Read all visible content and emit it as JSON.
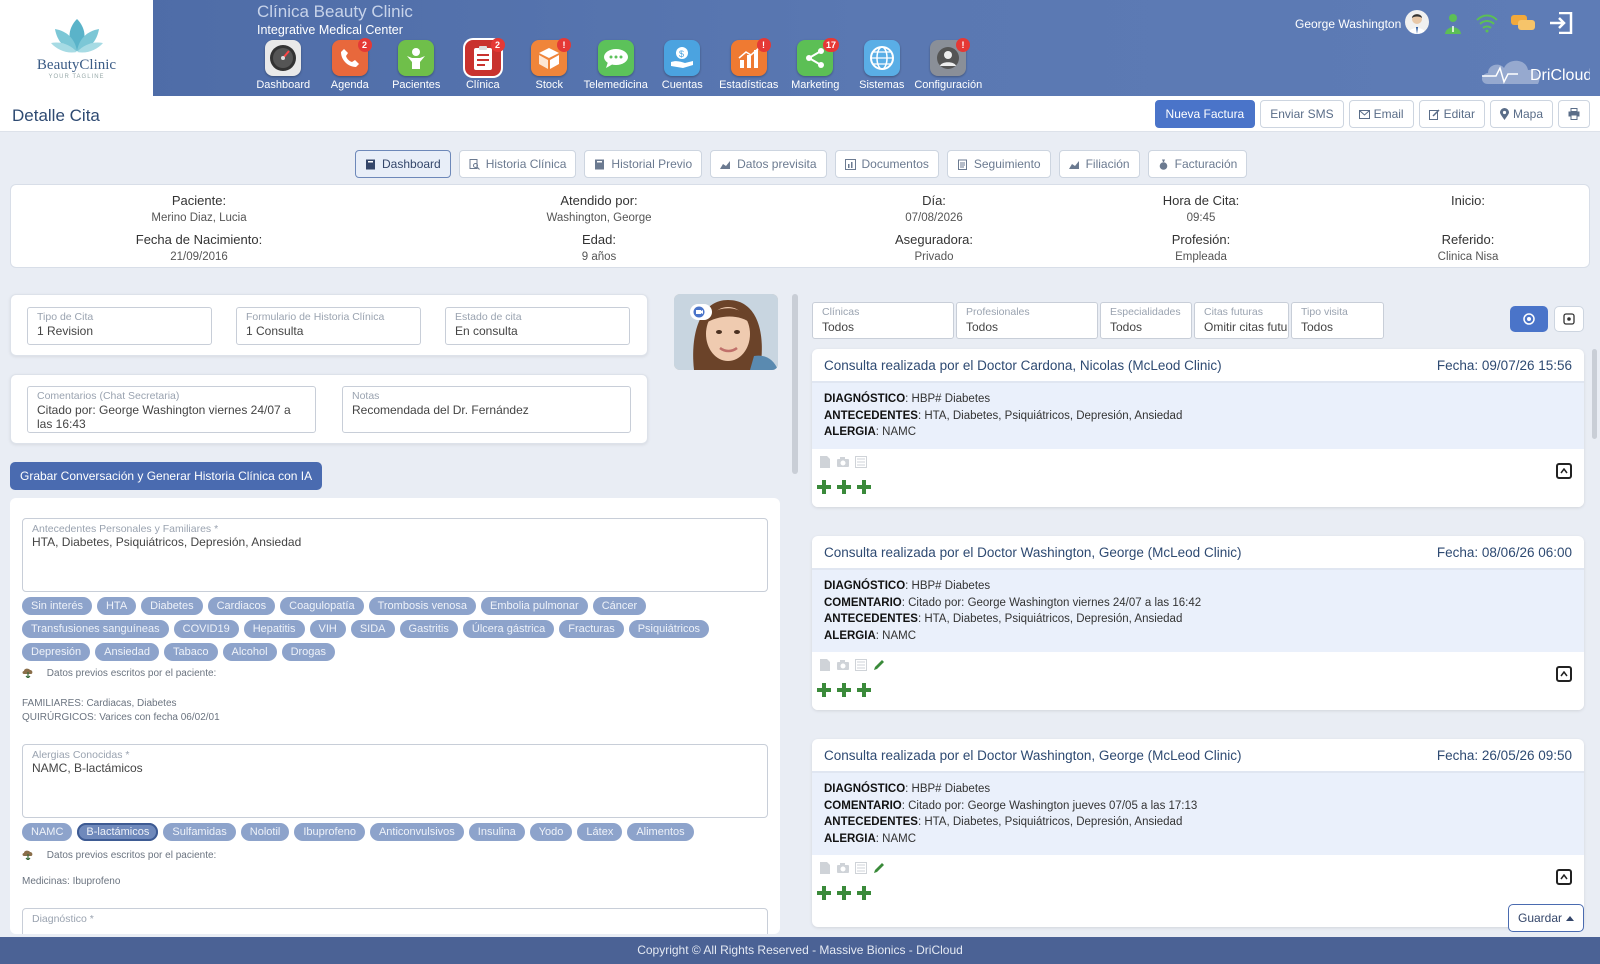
{
  "brand": {
    "name": "BeautyClinic",
    "tagline": "YOUR TAGLINE"
  },
  "header": {
    "clinic_title": "Clínica Beauty Clinic",
    "clinic_subtitle": "Integrative Medical Center",
    "user_name": "George Washington",
    "cloud_brand": "DriCloud"
  },
  "nav": [
    {
      "label": "Dashboard",
      "icon": "speedometer-icon",
      "badge": ""
    },
    {
      "label": "Agenda",
      "icon": "phone-icon",
      "badge": "2"
    },
    {
      "label": "Pacientes",
      "icon": "patient-icon",
      "badge": ""
    },
    {
      "label": "Clínica",
      "icon": "clipboard-icon",
      "badge": "2"
    },
    {
      "label": "Stock",
      "icon": "box-icon",
      "badge": "!"
    },
    {
      "label": "Telemedicina",
      "icon": "chat-icon",
      "badge": ""
    },
    {
      "label": "Cuentas",
      "icon": "money-hand-icon",
      "badge": ""
    },
    {
      "label": "Estadísticas",
      "icon": "bar-chart-icon",
      "badge": "!"
    },
    {
      "label": "Marketing",
      "icon": "share-icon",
      "badge": "17"
    },
    {
      "label": "Sistemas",
      "icon": "globe-icon",
      "badge": ""
    },
    {
      "label": "Configuración",
      "icon": "user-gear-icon",
      "badge": "!"
    }
  ],
  "page": {
    "title": "Detalle Cita"
  },
  "actions": {
    "nueva_factura": "Nueva Factura",
    "enviar_sms": "Enviar SMS",
    "email": "Email",
    "editar": "Editar",
    "mapa": "Mapa"
  },
  "tabs": [
    "Dashboard",
    "Historia Clínica",
    "Historial Previo",
    "Datos previsita",
    "Documentos",
    "Seguimiento",
    "Filiación",
    "Facturación"
  ],
  "patient": {
    "paciente_label": "Paciente:",
    "paciente": "Merino Diaz, Lucia",
    "atendido_label": "Atendido por:",
    "atendido": "Washington, George",
    "dia_label": "Día:",
    "dia": "07/08/2026",
    "hora_label": "Hora de Cita:",
    "hora": "09:45",
    "inicio_label": "Inicio:",
    "inicio": "",
    "nacimiento_label": "Fecha de Nacimiento:",
    "nacimiento": "21/09/2016",
    "edad_label": "Edad:",
    "edad": "9 años",
    "aseguradora_label": "Aseguradora:",
    "aseguradora": "Privado",
    "profesion_label": "Profesión:",
    "profesion": "Empleada",
    "referido_label": "Referido:",
    "referido": "Clinica Nisa"
  },
  "cita": {
    "tipo_label": "Tipo de Cita",
    "tipo": "1 Revision",
    "formulario_label": "Formulario de Historia Clínica",
    "formulario": "1 Consulta",
    "estado_label": "Estado de cita",
    "estado": "En consulta",
    "comentarios_label": "Comentarios (Chat Secretaria)",
    "comentarios": "Citado por: George Washington viernes 24/07 a las 16:43",
    "notas_label": "Notas",
    "notas": "Recomendada del Dr. Fernández"
  },
  "ai_button": "Grabar Conversación y Generar Historia Clínica con IA",
  "antecedentes": {
    "label": "Antecedentes Personales y Familiares *",
    "value": "HTA, Diabetes, Psiquiátricos, Depresión, Ansiedad",
    "chips": [
      "Sin interés",
      "HTA",
      "Diabetes",
      "Cardiacos",
      "Coagulopatía",
      "Trombosis venosa",
      "Embolia pulmonar",
      "Cáncer",
      "Transfusiones sanguíneas",
      "COVID19",
      "Hepatitis",
      "VIH",
      "SIDA",
      "Gastritis",
      "Úlcera gástrica",
      "Fracturas",
      "Psiquiátricos",
      "Depresión",
      "Ansiedad",
      "Tabaco",
      "Alcohol",
      "Drogas"
    ],
    "prev_title": "Datos previos escritos por el paciente:",
    "prev_line1": "FAMILIARES: Cardiacas, Diabetes",
    "prev_line2": "QUIRÚRGICOS: Varices con fecha 06/02/01"
  },
  "alergias": {
    "label": "Alergias Conocidas *",
    "value": "NAMC, B-lactámicos",
    "chips": [
      "NAMC",
      "B-lactámicos",
      "Sulfamidas",
      "Nolotil",
      "Ibuprofeno",
      "Anticonvulsivos",
      "Insulina",
      "Yodo",
      "Látex",
      "Alimentos"
    ],
    "prev_title": "Datos previos escritos por el paciente:",
    "prev_line1": "Medicinas: Ibuprofeno"
  },
  "diagnostico": {
    "label": "Diagnóstico *"
  },
  "filters": [
    {
      "label": "Clínicas",
      "value": "Todos"
    },
    {
      "label": "Profesionales",
      "value": "Todos"
    },
    {
      "label": "Especialidades",
      "value": "Todos"
    },
    {
      "label": "Citas futuras",
      "value": "Omitir citas futu"
    },
    {
      "label": "Tipo visita",
      "value": "Todos"
    }
  ],
  "records": [
    {
      "title": "Consulta realizada por el Doctor Cardona, Nicolas (McLeod Clinic)",
      "date": "Fecha: 09/07/26 15:56",
      "diag_label": "DIAGNÓSTICO",
      "diag": ": HBP# Diabetes",
      "coment_label": "",
      "coment": "",
      "ante_label": "ANTECEDENTES",
      "ante": ": HTA, Diabetes, Psiquiátricos, Depresión, Ansiedad",
      "alergia_label": "ALERGIA",
      "alergia": ": NAMC"
    },
    {
      "title": "Consulta realizada por el Doctor Washington, George (McLeod Clinic)",
      "date": "Fecha: 08/06/26 06:00",
      "diag_label": "DIAGNÓSTICO",
      "diag": ": HBP# Diabetes",
      "coment_label": "COMENTARIO",
      "coment": ": Citado por: George Washington viernes 24/07 a las 16:42",
      "ante_label": "ANTECEDENTES",
      "ante": ": HTA, Diabetes, Psiquiátricos, Depresión, Ansiedad",
      "alergia_label": "ALERGIA",
      "alergia": ": NAMC"
    },
    {
      "title": "Consulta realizada por el Doctor Washington, George (McLeod Clinic)",
      "date": "Fecha: 26/05/26 09:50",
      "diag_label": "DIAGNÓSTICO",
      "diag": ": HBP# Diabetes",
      "coment_label": "COMENTARIO",
      "coment": ": Citado por: George Washington jueves 07/05 a las 17:13",
      "ante_label": "ANTECEDENTES",
      "ante": ": HTA, Diabetes, Psiquiátricos, Depresión, Ansiedad",
      "alergia_label": "ALERGIA",
      "alergia": ": NAMC"
    }
  ],
  "guardar": "Guardar",
  "footer": "Copyright © All Rights Reserved - Massive Bionics - DriCloud",
  "colors": {
    "primary": "#4a74c9",
    "header": "#5a78b2",
    "chip": "#8da3cb",
    "plus": "#3a8a3a",
    "badge": "#e53935"
  }
}
